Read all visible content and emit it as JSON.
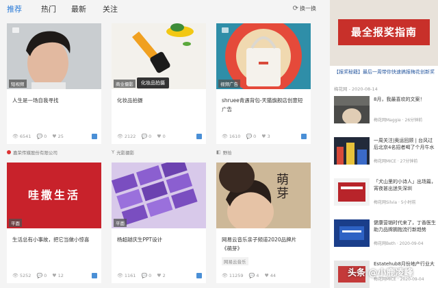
{
  "tabs": [
    {
      "label": "推荐"
    },
    {
      "label": "热门"
    },
    {
      "label": "最新"
    },
    {
      "label": "关注"
    }
  ],
  "swap_label": "换一换",
  "tooltip": "化妆品拍摄",
  "cards": [
    {
      "tag": "短视频",
      "title": "人生是一场自我寻找",
      "views": "6541",
      "comments": "0",
      "likes": "25"
    },
    {
      "tag": "商业摄影",
      "title": "化妆品拍摄",
      "views": "2122",
      "comments": "0",
      "likes": "0"
    },
    {
      "tag": "视频广告",
      "title": "shruee青遇背包-天猫旗舰店创意短广告",
      "views": "1610",
      "comments": "0",
      "likes": "3"
    },
    {
      "tag": "平面",
      "title": "生活总有小事故，把它当做小惊喜",
      "banner_text": "哇撒生活",
      "views": "5252",
      "comments": "0",
      "likes": "12"
    },
    {
      "tag": "平面",
      "title": "杨超越庆生PPT设计",
      "views": "1161",
      "comments": "0",
      "likes": "2"
    },
    {
      "tag": "",
      "title": "网易云音乐亲子频道2020品牌片《萌芽》",
      "sub_tag": "网易云音乐",
      "poster_text": "萌芽",
      "views": "11259",
      "comments": "4",
      "likes": "44"
    }
  ],
  "owners": [
    {
      "name": "嘉荣传媒股份有限公司"
    },
    {
      "name": "光影摄影"
    },
    {
      "name": "野拾"
    }
  ],
  "sidebar": {
    "banner_text": "最全报奖指南",
    "feature_title": "【报奖秘籍】最后一周带你快速搞报梅花创新奖",
    "feature_meta": "梅花网 - 2020-08-14",
    "items": [
      {
        "text": "8月，我最喜欢的文案！",
        "meta": "梅花网Maggie · 26分钟前"
      },
      {
        "text": "一周关注|奥运回顾 | 台风过后北京4名招者喝了个月牛水",
        "meta": "梅花网MICE · 27分钟前"
      },
      {
        "text": "「犬山里的小诗人」出场篇，宵夜甚出迷失深圳",
        "meta": "梅花网Silvia · 5小时前"
      },
      {
        "text": "健康营销时代来了，丁香医生助力品牌拥抱流行新趋势",
        "meta": "梅花网Beth · 2020-09-04"
      },
      {
        "text": "Estatehub8月份地产行业大",
        "meta": "梅花网MICE · 2020-09-04"
      }
    ]
  },
  "watermark": "头条 @小鹿凌峰"
}
